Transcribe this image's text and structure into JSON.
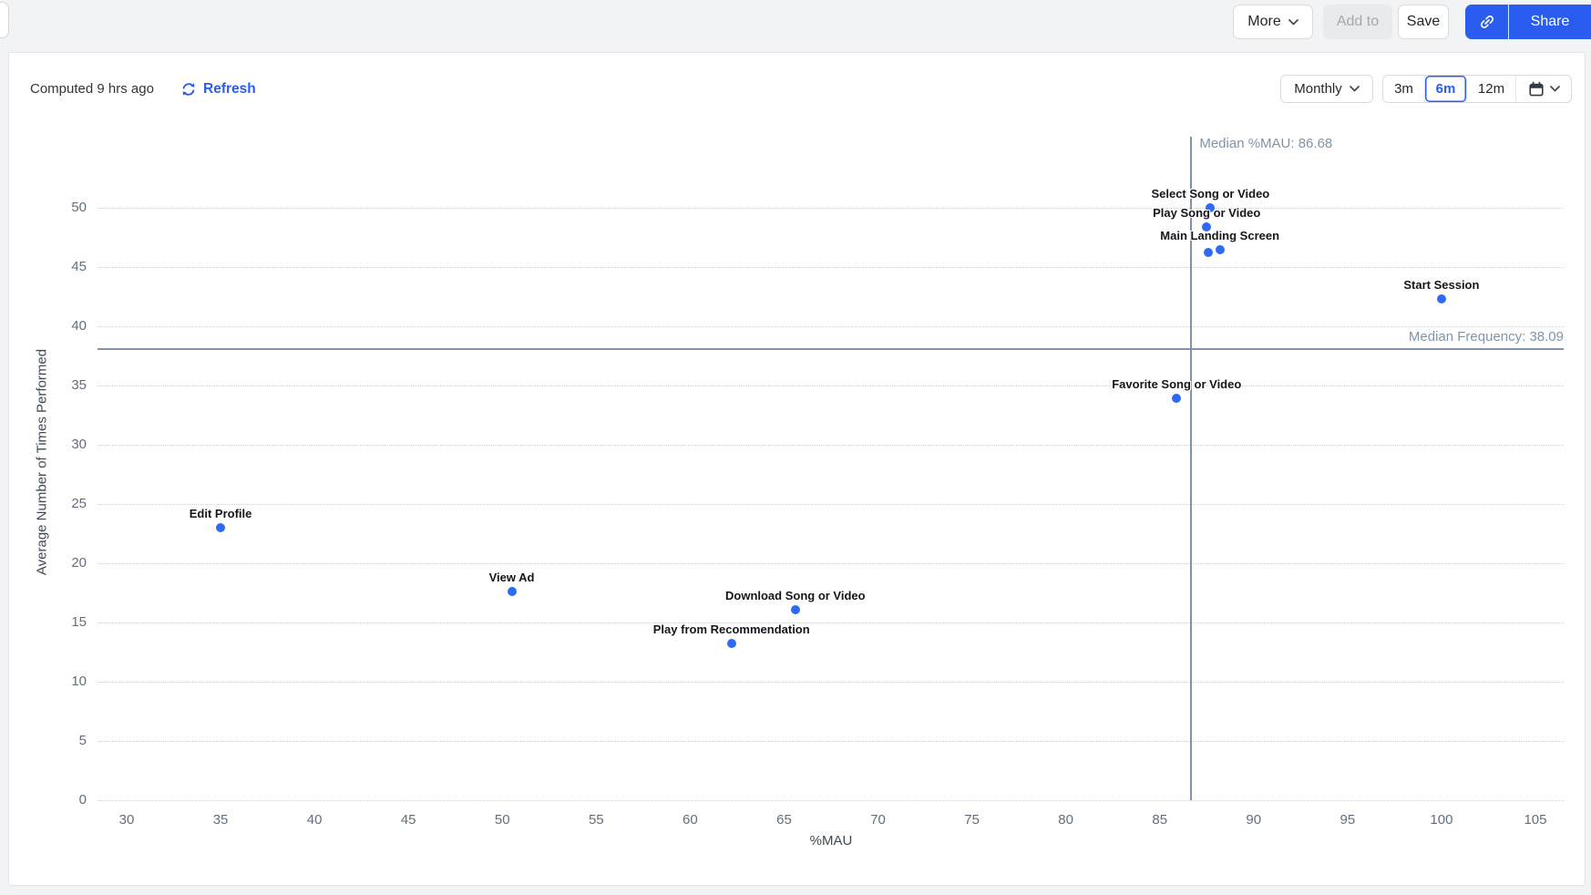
{
  "toolbar": {
    "more_label": "More",
    "add_to_label": "Add to",
    "save_label": "Save",
    "share_label": "Share"
  },
  "statusbar": {
    "computed_text": "Computed 9 hrs ago",
    "refresh_label": "Refresh",
    "interval_selected": "Monthly",
    "range_options": [
      "3m",
      "6m",
      "12m"
    ],
    "range_selected": "6m"
  },
  "colors": {
    "accent_blue": "#2a5cf0",
    "point_blue": "#2e6af3",
    "median_gray": "#8093a8"
  },
  "chart_data": {
    "type": "scatter",
    "xlabel": "%MAU",
    "ylabel": "Average Number of Times Performed",
    "x_ticks": [
      30,
      35,
      40,
      45,
      50,
      55,
      60,
      65,
      70,
      75,
      80,
      85,
      90,
      95,
      100,
      105
    ],
    "y_ticks": [
      0,
      5,
      10,
      15,
      20,
      25,
      30,
      35,
      40,
      45,
      50
    ],
    "xlim": [
      28.5,
      106.5
    ],
    "ylim": [
      0,
      52
    ],
    "grid": "horizontal-dotted",
    "median_x": {
      "value": 86.68,
      "label": "Median %MAU: 86.68"
    },
    "median_y": {
      "value": 38.09,
      "label": "Median Frequency: 38.09"
    },
    "points": [
      {
        "label": "Select Song or Video",
        "x": 87.7,
        "y": 50.0
      },
      {
        "label": "Play Song or Video",
        "x": 87.5,
        "y": 48.4
      },
      {
        "label": "Main Landing Screen",
        "x": 88.2,
        "y": 46.5
      },
      {
        "label": "",
        "x": 87.6,
        "y": 46.2
      },
      {
        "label": "Start Session",
        "x": 100.0,
        "y": 42.3
      },
      {
        "label": "Favorite Song or Video",
        "x": 85.9,
        "y": 33.9
      },
      {
        "label": "Edit Profile",
        "x": 35.0,
        "y": 23.0
      },
      {
        "label": "View Ad",
        "x": 50.5,
        "y": 17.6
      },
      {
        "label": "Download Song or Video",
        "x": 65.6,
        "y": 16.1
      },
      {
        "label": "Play from Recommendation",
        "x": 62.2,
        "y": 13.2
      }
    ]
  }
}
